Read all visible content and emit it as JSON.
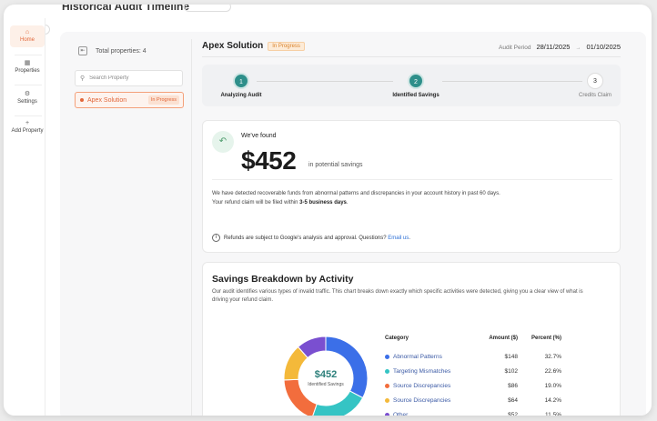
{
  "background": {
    "title": "Historical Audit Timeline"
  },
  "rail": {
    "items": [
      {
        "label": "Home",
        "icon": "home-icon"
      },
      {
        "label": "Properties",
        "icon": "grid-icon"
      },
      {
        "label": "Settings",
        "icon": "gear-icon"
      },
      {
        "label": "Add Property",
        "icon": "plus-icon"
      }
    ]
  },
  "sidebar": {
    "total_label": "Total properties: 4",
    "search_placeholder": "Search Property",
    "properties": [
      {
        "name": "Apex Solution",
        "status": "In Progress"
      }
    ]
  },
  "main": {
    "title": "Apex Solution",
    "status": "In Progress",
    "audit_period_label": "Audit Period",
    "audit_start": "28/11/2025",
    "audit_arrow": "→",
    "audit_end": "01/10/2025"
  },
  "steps": [
    {
      "number": "1",
      "label": "Analyzing Audit",
      "state": "done"
    },
    {
      "number": "2",
      "label": "Identified Savings",
      "state": "done"
    },
    {
      "number": "3",
      "label": "Credits Claim",
      "state": "pending"
    }
  ],
  "found": {
    "heading": "We've found",
    "amount": "$452",
    "amount_suffix": "in potential savings",
    "desc_line1": "We have detected recoverable funds from abnormal patterns and discrepancies in your account history in past 60 days.",
    "desc_line2_prefix": "Your refund claim will be filed within ",
    "desc_line2_bold": "3-5 business days",
    "desc_line2_suffix": ".",
    "note_prefix": "Refunds are subject to Google's analysis and approval. Questions? ",
    "note_link": "Email us",
    "note_suffix": "."
  },
  "breakdown": {
    "title": "Savings Breakdown by Activity",
    "subtitle": "Our audit identifies various types of invalid traffic. This chart breaks down exactly which specific activities were detected, giving you a clear view of what is driving your refund claim.",
    "center_value": "$452",
    "center_label": "Identified Savings",
    "columns": [
      "Category",
      "Amount ($)",
      "Percent (%)"
    ],
    "rows": [
      {
        "category": "Abnormal Patterns",
        "amount": "$148",
        "percent": "32.7%",
        "color": "#3b6fe8",
        "value": 148
      },
      {
        "category": "Targeting Mismatches",
        "amount": "$102",
        "percent": "22.6%",
        "color": "#35c4c4",
        "value": 102
      },
      {
        "category": "Source Discrepancies",
        "amount": "$86",
        "percent": "19.0%",
        "color": "#f26d3d",
        "value": 86
      },
      {
        "category": "Source Discrepancies",
        "amount": "$64",
        "percent": "14.2%",
        "color": "#f4b93a",
        "value": 64
      },
      {
        "category": "Other",
        "amount": "$52",
        "percent": "11.5%",
        "color": "#7a4fd0",
        "value": 52
      }
    ]
  }
}
